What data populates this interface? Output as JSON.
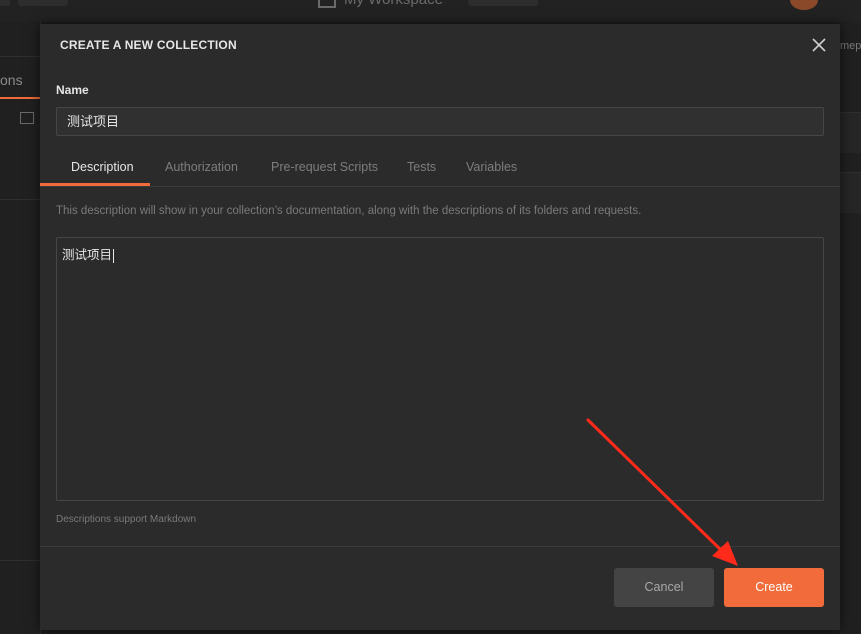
{
  "background": {
    "workspace_label": "My Workspace",
    "left_tab_fragment": "ons",
    "right_fragment": "mep"
  },
  "modal": {
    "title": "CREATE A NEW COLLECTION",
    "close_icon": "close-icon",
    "name_label": "Name",
    "name_value": "测试项目",
    "tabs": [
      {
        "label": "Description",
        "active": true
      },
      {
        "label": "Authorization",
        "active": false
      },
      {
        "label": "Pre-request Scripts",
        "active": false
      },
      {
        "label": "Tests",
        "active": false
      },
      {
        "label": "Variables",
        "active": false
      }
    ],
    "description_help": "This description will show in your collection’s documentation, along with the descriptions of its folders and requests.",
    "description_value": "测试项目",
    "markdown_note": "Descriptions support Markdown",
    "cancel_label": "Cancel",
    "create_label": "Create"
  },
  "colors": {
    "accent": "#f26b3a",
    "modal_bg": "#2b2b2b",
    "annotation_arrow": "#ff2a1a"
  }
}
